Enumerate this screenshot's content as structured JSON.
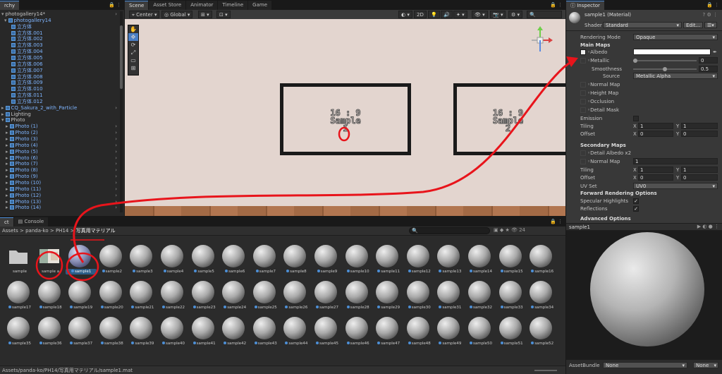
{
  "hierarchy": {
    "tab": "rchy",
    "root": "photogallery14*",
    "child_group": "photogallery14",
    "cubes": [
      "立方体",
      "立方体.001",
      "立方体.002",
      "立方体.003",
      "立方体.004",
      "立方体.005",
      "立方体.006",
      "立方体.007",
      "立方体.008",
      "立方体.009",
      "立方体.010",
      "立方体.011",
      "立方体.012"
    ],
    "others": [
      "CQ_Sakura_2_with_Particle",
      "Lighting",
      "Photo"
    ],
    "photos": [
      "Photo (1)",
      "Photo (2)",
      "Photo (3)",
      "Photo (4)",
      "Photo (5)",
      "Photo (6)",
      "Photo (7)",
      "Photo (8)",
      "Photo (9)",
      "Photo (10)",
      "Photo (11)",
      "Photo (12)",
      "Photo (13)",
      "Photo (14)"
    ]
  },
  "scene": {
    "tabs": [
      "Scene",
      "Asset Store",
      "Animator",
      "Timeline",
      "Game"
    ],
    "pivot": "Center",
    "space": "Global",
    "mode_2d": "2D",
    "frames": [
      {
        "text": "16 : 9\nSample\n1"
      },
      {
        "text": "16 : 9\nSample\n2"
      }
    ],
    "tools": [
      "✋",
      "✥",
      "⟳",
      "⤢",
      "▭",
      "⊞"
    ]
  },
  "inspector": {
    "tab": "Inspector",
    "material_name": "sample1 (Material)",
    "shader_label": "Shader",
    "shader_value": "Standard",
    "edit_label": "Edit...",
    "rendering_mode_label": "Rendering Mode",
    "rendering_mode_value": "Opaque",
    "main_maps": "Main Maps",
    "albedo": "Albedo",
    "metallic": "Metallic",
    "metallic_value": "0",
    "metallic_fraction": 0,
    "smoothness": "Smoothness",
    "smoothness_value": "0.5",
    "smoothness_fraction": 0.5,
    "source": "Source",
    "source_value": "Metallic Alpha",
    "normal_map": "Normal Map",
    "height_map": "Height Map",
    "occlusion": "Occlusion",
    "detail_mask": "Detail Mask",
    "emission": "Emission",
    "tiling": "Tiling",
    "offset": "Offset",
    "x": "X",
    "y": "Y",
    "tiling_x": "1",
    "tiling_y": "1",
    "offset_x": "0",
    "offset_y": "0",
    "secondary_maps": "Secondary Maps",
    "detail_albedo": "Detail Albedo x2",
    "normal_map2": "Normal Map",
    "normal_map2_value": "1",
    "tiling2_x": "1",
    "tiling2_y": "1",
    "offset2_x": "0",
    "offset2_y": "0",
    "uv_set": "UV Set",
    "uv_set_value": "UV0",
    "forward_options": "Forward Rendering Options",
    "specular_highlights": "Specular Highlights",
    "reflections": "Reflections",
    "advanced_options": "Advanced Options",
    "preview_name": "sample1",
    "asset_bundle": "AssetBundle",
    "asset_bundle_value": "None",
    "asset_bundle_variant": "None"
  },
  "project": {
    "tabs": [
      "ct",
      "Console"
    ],
    "breadcrumb": [
      "Assets",
      "panda-ko",
      "PH14",
      "写真用マテリアル"
    ],
    "count": "24",
    "status_path": "Assets/panda-ko/PH14/写真用マテリアル/sample1.mat",
    "items": [
      "sample",
      "sample a",
      "sample1",
      "sample2",
      "sample3",
      "sample4",
      "sample5",
      "sample6",
      "sample7",
      "sample8",
      "sample9",
      "sample10",
      "sample11",
      "sample12",
      "sample13",
      "sample14",
      "sample15",
      "sample16",
      "sample17",
      "sample18",
      "sample19",
      "sample20",
      "sample21",
      "sample22",
      "sample23",
      "sample24",
      "sample25",
      "sample26",
      "sample27",
      "sample28",
      "sample29",
      "sample30",
      "sample31",
      "sample32",
      "sample33",
      "sample34",
      "sample35",
      "sample36",
      "sample37",
      "sample38",
      "sample39",
      "sample40",
      "sample41",
      "sample42",
      "sample43",
      "sample44",
      "sample45",
      "sample46",
      "sample47",
      "sample48",
      "sample49",
      "sample50",
      "sample51",
      "sample52"
    ]
  },
  "colors": {
    "accent": "#4a7ec4",
    "annotation_red": "#e8141b",
    "wall": "#e3d5cf"
  }
}
